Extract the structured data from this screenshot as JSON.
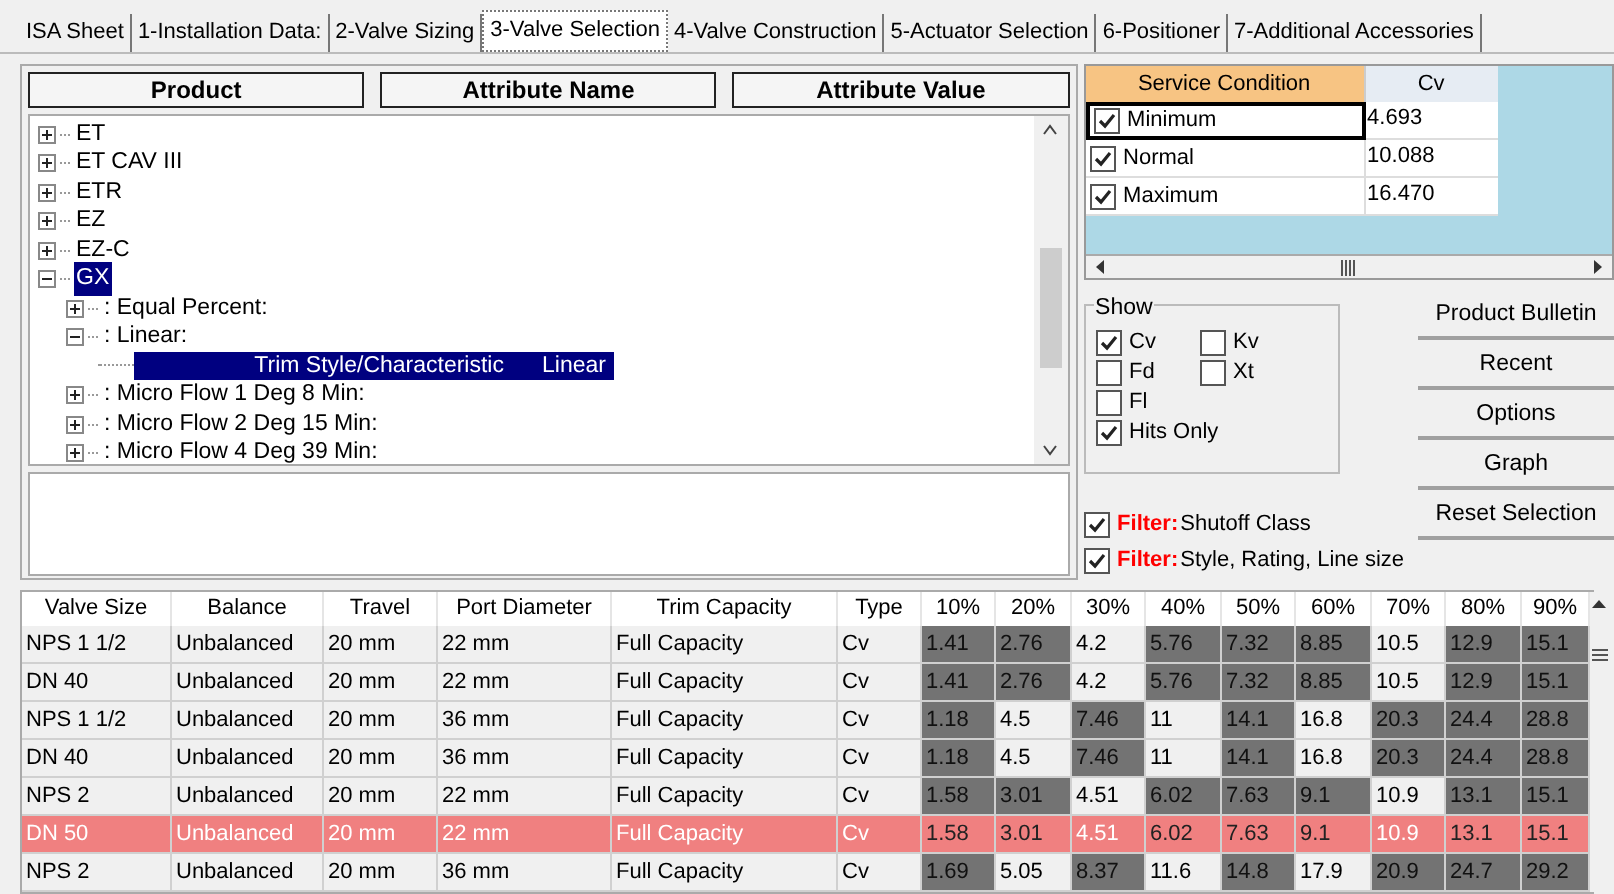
{
  "tabs": [
    {
      "label": "ISA Sheet",
      "selected": false
    },
    {
      "label": "1-Installation Data:",
      "selected": false
    },
    {
      "label": "2-Valve Sizing",
      "selected": false
    },
    {
      "label": "3-Valve Selection",
      "selected": true
    },
    {
      "label": "4-Valve Construction",
      "selected": false
    },
    {
      "label": "5-Actuator Selection",
      "selected": false
    },
    {
      "label": "6-Positioner",
      "selected": false
    },
    {
      "label": "7-Additional Accessories",
      "selected": false
    }
  ],
  "product_tree": {
    "columns": [
      "Product",
      "Attribute Name",
      "Attribute Value"
    ],
    "items": [
      {
        "kind": "node",
        "label": "ET",
        "expanded": false,
        "selected": false
      },
      {
        "kind": "node",
        "label": "ET CAV III",
        "expanded": false,
        "selected": false
      },
      {
        "kind": "node",
        "label": "ETR",
        "expanded": false,
        "selected": false
      },
      {
        "kind": "node",
        "label": "EZ",
        "expanded": false,
        "selected": false
      },
      {
        "kind": "node",
        "label": "EZ-C",
        "expanded": false,
        "selected": false
      },
      {
        "kind": "node",
        "label": "GX",
        "expanded": true,
        "selected": true,
        "children": [
          {
            "kind": "node",
            "label": ": Equal Percent:",
            "expanded": false,
            "selected": false
          },
          {
            "kind": "node",
            "label": ": Linear:",
            "expanded": true,
            "selected": false,
            "children": [
              {
                "kind": "attribute",
                "name": "Trim Style/Characteristic",
                "value": "Linear",
                "selected": true
              }
            ]
          },
          {
            "kind": "node",
            "label": ": Micro Flow 1 Deg 8 Min:",
            "expanded": false,
            "selected": false
          },
          {
            "kind": "node",
            "label": ": Micro Flow 2 Deg 15 Min:",
            "expanded": false,
            "selected": false
          },
          {
            "kind": "node",
            "label": ": Micro Flow 4 Deg 39 Min:",
            "expanded": false,
            "selected": false
          }
        ]
      }
    ]
  },
  "service_conditions": {
    "columns": [
      "Service Condition",
      "Cv"
    ],
    "rows": [
      {
        "label": "Minimum",
        "checked": true,
        "cv": "4.693",
        "selected": true
      },
      {
        "label": "Normal",
        "checked": true,
        "cv": "10.088",
        "selected": false
      },
      {
        "label": "Maximum",
        "checked": true,
        "cv": "16.470",
        "selected": false
      }
    ]
  },
  "show": {
    "title": "Show",
    "options": [
      {
        "label": "Cv",
        "checked": true
      },
      {
        "label": "Kv",
        "checked": false
      },
      {
        "label": "Fd",
        "checked": false
      },
      {
        "label": "Xt",
        "checked": false
      },
      {
        "label": "Fl",
        "checked": false
      },
      {
        "label": "Hits Only",
        "checked": true
      }
    ]
  },
  "buttons": [
    "Product Bulletin",
    "Recent",
    "Options",
    "Graph",
    "Reset Selection"
  ],
  "filters": [
    {
      "tag": "Filter:",
      "label": "Shutoff Class",
      "checked": true
    },
    {
      "tag": "Filter:",
      "label": "Style, Rating, Line size",
      "checked": true
    }
  ],
  "results": {
    "columns": [
      "Valve Size",
      "Balance",
      "Travel",
      "Port Diameter",
      "Trim Capacity",
      "Type",
      "10%",
      "20%",
      "30%",
      "40%",
      "50%",
      "60%",
      "70%",
      "80%",
      "90%"
    ],
    "rows": [
      {
        "selected": false,
        "cells": [
          "NPS 1 1/2",
          "Unbalanced",
          "20 mm",
          "22 mm",
          "Full Capacity",
          "Cv"
        ],
        "values": [
          {
            "value": "1.41",
            "hit": true
          },
          {
            "value": "2.76",
            "hit": true
          },
          {
            "value": "4.2",
            "hit": false
          },
          {
            "value": "5.76",
            "hit": true
          },
          {
            "value": "7.32",
            "hit": true
          },
          {
            "value": "8.85",
            "hit": true
          },
          {
            "value": "10.5",
            "hit": false
          },
          {
            "value": "12.9",
            "hit": true
          },
          {
            "value": "15.1",
            "hit": true
          }
        ]
      },
      {
        "selected": false,
        "cells": [
          "DN 40",
          "Unbalanced",
          "20 mm",
          "22 mm",
          "Full Capacity",
          "Cv"
        ],
        "values": [
          {
            "value": "1.41",
            "hit": true
          },
          {
            "value": "2.76",
            "hit": true
          },
          {
            "value": "4.2",
            "hit": false
          },
          {
            "value": "5.76",
            "hit": true
          },
          {
            "value": "7.32",
            "hit": true
          },
          {
            "value": "8.85",
            "hit": true
          },
          {
            "value": "10.5",
            "hit": false
          },
          {
            "value": "12.9",
            "hit": true
          },
          {
            "value": "15.1",
            "hit": true
          }
        ]
      },
      {
        "selected": false,
        "cells": [
          "NPS 1 1/2",
          "Unbalanced",
          "20 mm",
          "36 mm",
          "Full Capacity",
          "Cv"
        ],
        "values": [
          {
            "value": "1.18",
            "hit": true
          },
          {
            "value": "4.5",
            "hit": false
          },
          {
            "value": "7.46",
            "hit": true
          },
          {
            "value": "11",
            "hit": false
          },
          {
            "value": "14.1",
            "hit": true
          },
          {
            "value": "16.8",
            "hit": false
          },
          {
            "value": "20.3",
            "hit": true
          },
          {
            "value": "24.4",
            "hit": true
          },
          {
            "value": "28.8",
            "hit": true
          }
        ]
      },
      {
        "selected": false,
        "cells": [
          "DN 40",
          "Unbalanced",
          "20 mm",
          "36 mm",
          "Full Capacity",
          "Cv"
        ],
        "values": [
          {
            "value": "1.18",
            "hit": true
          },
          {
            "value": "4.5",
            "hit": false
          },
          {
            "value": "7.46",
            "hit": true
          },
          {
            "value": "11",
            "hit": false
          },
          {
            "value": "14.1",
            "hit": true
          },
          {
            "value": "16.8",
            "hit": false
          },
          {
            "value": "20.3",
            "hit": true
          },
          {
            "value": "24.4",
            "hit": true
          },
          {
            "value": "28.8",
            "hit": true
          }
        ]
      },
      {
        "selected": false,
        "cells": [
          "NPS 2",
          "Unbalanced",
          "20 mm",
          "22 mm",
          "Full Capacity",
          "Cv"
        ],
        "values": [
          {
            "value": "1.58",
            "hit": true
          },
          {
            "value": "3.01",
            "hit": true
          },
          {
            "value": "4.51",
            "hit": false
          },
          {
            "value": "6.02",
            "hit": true
          },
          {
            "value": "7.63",
            "hit": true
          },
          {
            "value": "9.1",
            "hit": true
          },
          {
            "value": "10.9",
            "hit": false
          },
          {
            "value": "13.1",
            "hit": true
          },
          {
            "value": "15.1",
            "hit": true
          }
        ]
      },
      {
        "selected": true,
        "cells": [
          "DN 50",
          "Unbalanced",
          "20 mm",
          "22 mm",
          "Full Capacity",
          "Cv"
        ],
        "values": [
          {
            "value": "1.58",
            "hit": true
          },
          {
            "value": "3.01",
            "hit": true
          },
          {
            "value": "4.51",
            "hit": false
          },
          {
            "value": "6.02",
            "hit": true
          },
          {
            "value": "7.63",
            "hit": true
          },
          {
            "value": "9.1",
            "hit": true
          },
          {
            "value": "10.9",
            "hit": false
          },
          {
            "value": "13.1",
            "hit": true
          },
          {
            "value": "15.1",
            "hit": true
          }
        ]
      },
      {
        "selected": false,
        "cells": [
          "NPS 2",
          "Unbalanced",
          "20 mm",
          "36 mm",
          "Full Capacity",
          "Cv"
        ],
        "values": [
          {
            "value": "1.69",
            "hit": true
          },
          {
            "value": "5.05",
            "hit": false
          },
          {
            "value": "8.37",
            "hit": true
          },
          {
            "value": "11.6",
            "hit": false
          },
          {
            "value": "14.8",
            "hit": true
          },
          {
            "value": "17.9",
            "hit": false
          },
          {
            "value": "20.9",
            "hit": true
          },
          {
            "value": "24.7",
            "hit": true
          },
          {
            "value": "29.2",
            "hit": true
          }
        ]
      }
    ]
  }
}
